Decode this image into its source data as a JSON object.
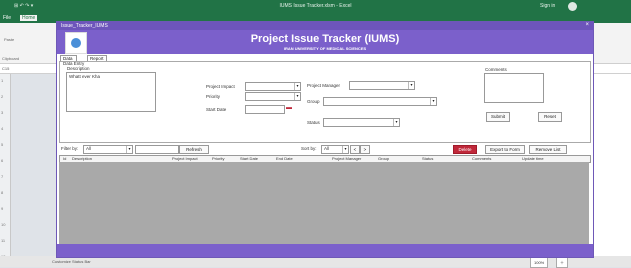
{
  "excel": {
    "title": "IUMS Issue Tracker.xlsm - Excel",
    "user": "Sign in",
    "quick_access": "⊞ ↶ ↷ ▾",
    "tabs": [
      "File",
      "Home"
    ],
    "ribbon_labels": [
      "Paste",
      "Clipboard"
    ],
    "name_box": "C15",
    "sheet_tab": "Tracker",
    "statusbar_left": "Customize Status Bar",
    "taskbar": [
      "100%",
      "＋"
    ]
  },
  "dialog": {
    "title": "Issue_Tracker_IUMS",
    "close": "×",
    "banner_title": "Project Issue Tracker (IUMS)",
    "banner_subtitle": "IRAN UNIVERSITY OF MEDICAL SCIENCES",
    "tabs": [
      "Data Entry",
      "Report"
    ],
    "panel_caption": "Data Entry",
    "description_label": "Description",
    "description_value": "Whatt ever Kha",
    "labels": {
      "project_impact": "Project Impact",
      "priority": "Priority",
      "start_date": "Start Date",
      "project_manager": "Project Manager",
      "group": "Group",
      "status": "Status",
      "comments": "Comments"
    },
    "buttons": {
      "submit": "Submit",
      "reset": "Reset",
      "refresh": "Refresh",
      "delete": "Delete",
      "export_form": "Export to Form",
      "remove_list": "Remove List",
      "prev": "<",
      "next": ">"
    },
    "filter": {
      "filter_by_label": "Filter by:",
      "filter_by_value": "All",
      "sort_by_label": "Sort by:",
      "sort_by_value": "All"
    },
    "table_headers": [
      "Id",
      "Description",
      "Project Impact",
      "Priority",
      "Start Date",
      "End Date",
      "Project Manager",
      "Group",
      "Status",
      "Comments",
      "Update time"
    ],
    "accent": "#7b60cb"
  }
}
